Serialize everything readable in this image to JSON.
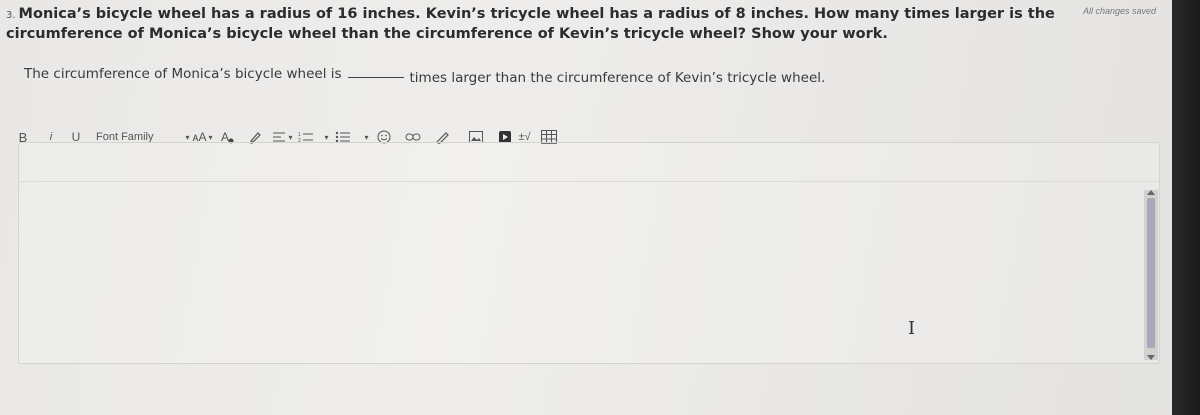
{
  "status": {
    "saved_text": "All changes saved"
  },
  "question": {
    "number": "3.",
    "text": "Monica’s bicycle wheel has a radius of 16 inches. Kevin’s tricycle wheel has a radius of 8 inches. How many times larger is the circumference of Monica’s bicycle wheel than the circumference of Kevin’s tricycle wheel? Show your work."
  },
  "answer": {
    "before": "The circumference of Monica’s bicycle wheel is",
    "after": "times larger than the circumference of Kevin’s tricycle wheel."
  },
  "toolbar": {
    "bold": "B",
    "italic": "i",
    "underline": "U",
    "font_family": "Font Family",
    "font_size_icon": "ᴀA",
    "math_label": "±√"
  },
  "colors": {
    "accent": "#a9a8b8",
    "text": "#2c2c2c",
    "background": "#eeedeb"
  }
}
